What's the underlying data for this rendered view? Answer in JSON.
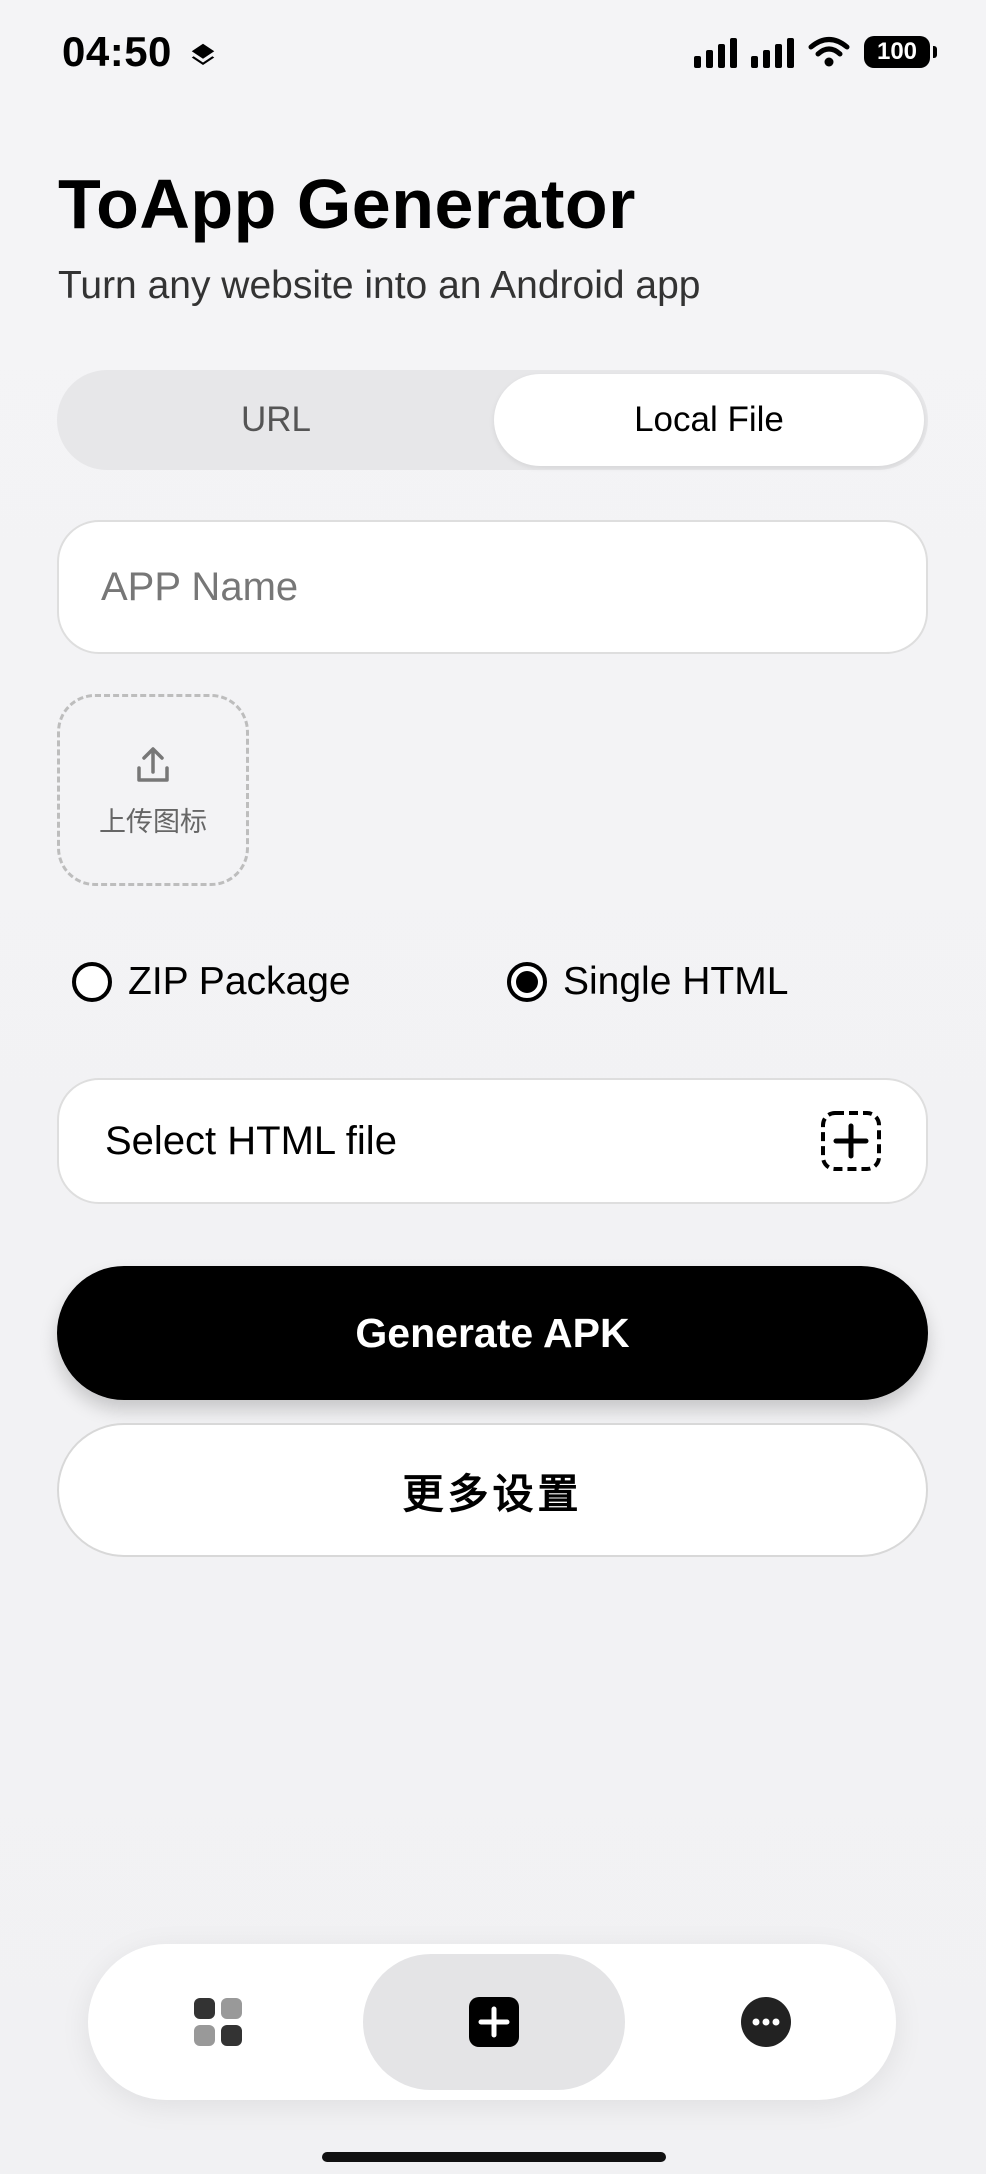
{
  "status_bar": {
    "time": "04:50",
    "battery": "100"
  },
  "header": {
    "title": "ToApp Generator",
    "subtitle": "Turn any website into an Android app"
  },
  "source_tabs": {
    "items": [
      {
        "label": "URL",
        "selected": false
      },
      {
        "label": "Local File",
        "selected": true
      }
    ]
  },
  "form": {
    "app_name": {
      "value": "",
      "placeholder": "APP Name"
    },
    "upload_icon_label": "上传图标",
    "package_type": {
      "options": [
        {
          "label": "ZIP Package",
          "selected": false
        },
        {
          "label": "Single HTML",
          "selected": true
        }
      ]
    },
    "select_file_label": "Select HTML file"
  },
  "actions": {
    "generate_label": "Generate APK",
    "more_settings_label": "更多设置"
  },
  "bottom_nav": {
    "items": [
      {
        "icon": "apps-grid-icon",
        "selected": false
      },
      {
        "icon": "plus-square-icon",
        "selected": true
      },
      {
        "icon": "more-dots-icon",
        "selected": false
      }
    ]
  },
  "colors": {
    "background": "#f2f2f4",
    "primary": "#000000",
    "surface": "#ffffff",
    "segment_track": "#e7e7e9"
  }
}
